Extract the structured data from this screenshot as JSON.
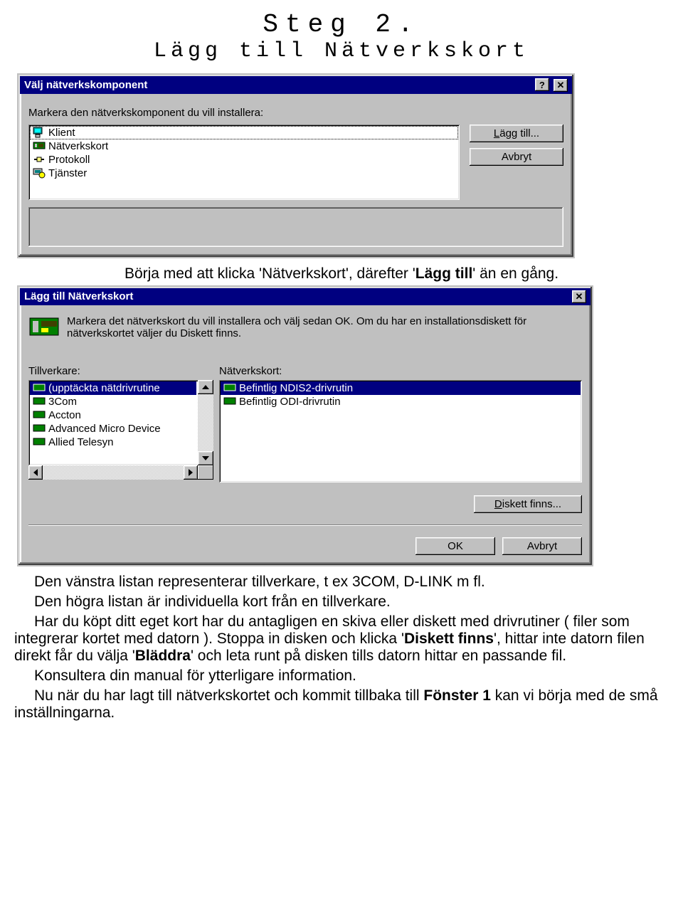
{
  "page": {
    "step": "Steg 2.",
    "subtitle": "Lägg till Nätverkskort",
    "intro_prefix": "Börja med att klicka 'Nätverkskort', därefter '",
    "intro_bold": "Lägg till",
    "intro_suffix": "' än en gång.",
    "p1": "Den vänstra listan representerar tillverkare, t ex 3COM, D-LINK m fl.",
    "p2": "Den högra listan är individuella kort från en tillverkare.",
    "p3a": "Har du köpt ditt eget kort har du antagligen en skiva eller diskett med drivrutiner ( filer som integrerar kortet med datorn ). Stoppa in disken och klicka '",
    "p3b": "Diskett finns",
    "p3c": "', hittar inte datorn filen direkt får du välja '",
    "p3d": "Bläddra",
    "p3e": "' och leta runt på disken tills datorn hittar en passande fil.",
    "p4": "Konsultera din manual för ytterligare information.",
    "p5a": "Nu när du har lagt till nätverkskortet och kommit tillbaka till ",
    "p5b": "Fönster 1",
    "p5c": " kan vi börja med de små inställningarna."
  },
  "dialog1": {
    "title": "Välj nätverkskomponent",
    "instruction": "Markera den nätverkskomponent du vill installera:",
    "items": [
      "Klient",
      "Nätverkskort",
      "Protokoll",
      "Tjänster"
    ],
    "btn_add_label": "Lägg till...",
    "btn_cancel": "Avbryt"
  },
  "dialog2": {
    "title": "Lägg till Nätverkskort",
    "instruction": "Markera det nätverkskort du vill installera och välj sedan OK. Om du har en installationsdiskett för nätverkskortet väljer du Diskett finns.",
    "manufacturer_label": "Tillverkare:",
    "adapter_label": "Nätverkskort:",
    "manufacturers": [
      "(upptäckta nätdrivrutine",
      "3Com",
      "Accton",
      "Advanced Micro Device",
      "Allied Telesyn"
    ],
    "adapters": [
      "Befintlig NDIS2-drivrutin",
      "Befintlig ODI-drivrutin"
    ],
    "btn_disk_label": "Diskett finns...",
    "btn_ok": "OK",
    "btn_cancel": "Avbryt"
  }
}
